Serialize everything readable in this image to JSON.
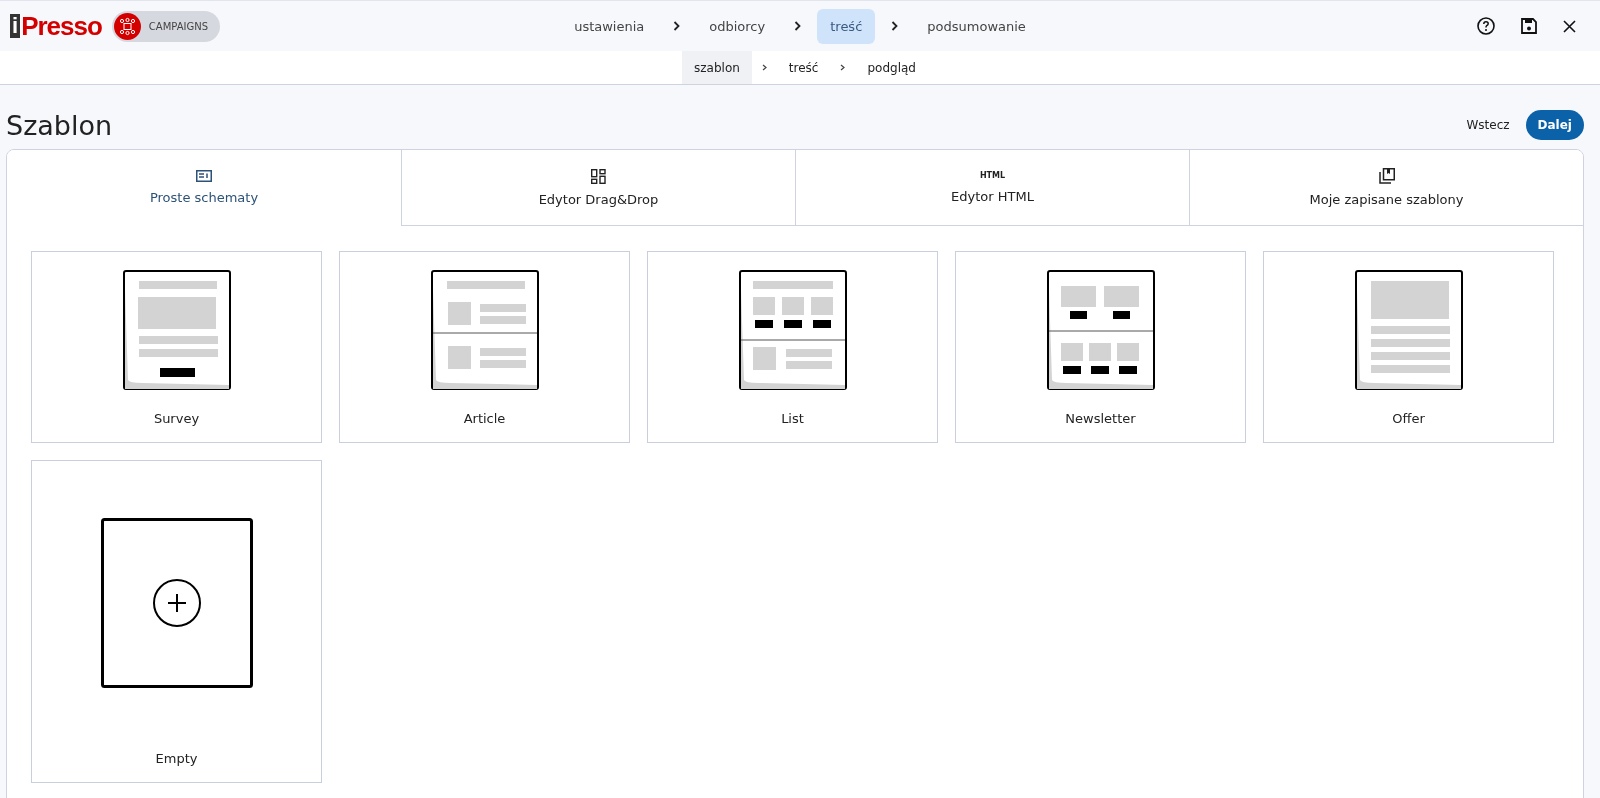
{
  "logo": {
    "mark": "i",
    "text": "Presso",
    "badge": "CAMPAIGNS"
  },
  "steps": [
    {
      "label": "ustawienia",
      "selected": false
    },
    {
      "label": "odbiorcy",
      "selected": false
    },
    {
      "label": "treść",
      "selected": true
    },
    {
      "label": "podsumowanie",
      "selected": false
    }
  ],
  "substeps": [
    {
      "label": "szablon",
      "selected": true
    },
    {
      "label": "treść",
      "selected": false
    },
    {
      "label": "podgląd",
      "selected": false
    }
  ],
  "title": "Szablon",
  "back_button": "Wstecz",
  "next_button": "Dalej",
  "tabs": [
    {
      "label": "Proste schematy",
      "kind": "schema",
      "selected": true
    },
    {
      "label": "Edytor Drag&Drop",
      "kind": "dragdrop",
      "selected": false
    },
    {
      "label": "Edytor HTML",
      "kind": "html",
      "icon_text": "HTML",
      "selected": false
    },
    {
      "label": "Moje zapisane szablony",
      "kind": "saved",
      "selected": false
    }
  ],
  "templates": [
    {
      "name": "Survey",
      "kind": "survey"
    },
    {
      "name": "Article",
      "kind": "article"
    },
    {
      "name": "List",
      "kind": "list"
    },
    {
      "name": "Newsletter",
      "kind": "newsletter"
    },
    {
      "name": "Offer",
      "kind": "offer"
    },
    {
      "name": "Empty",
      "kind": "empty"
    }
  ]
}
